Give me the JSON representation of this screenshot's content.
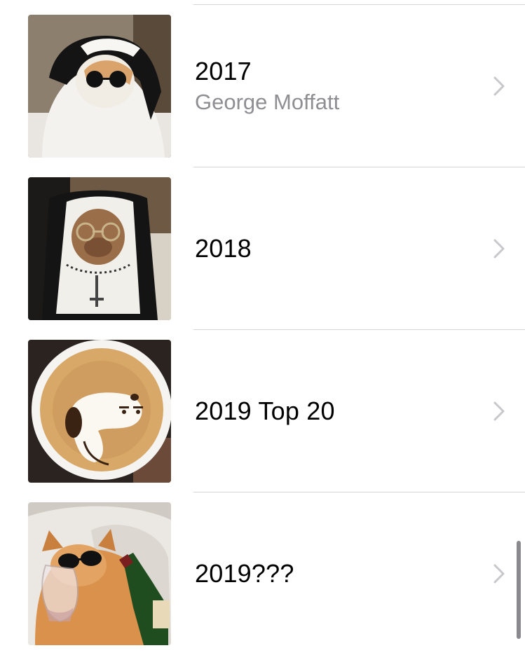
{
  "albums": [
    {
      "title": "2017",
      "subtitle": "George Moffatt",
      "thumbnail": "cat-in-nun-habit-sunglasses"
    },
    {
      "title": "2018",
      "subtitle": "",
      "thumbnail": "dog-in-nun-habit-glasses"
    },
    {
      "title": "2019 Top 20",
      "subtitle": "",
      "thumbnail": "snoopy-latte-art"
    },
    {
      "title": "2019???",
      "subtitle": "",
      "thumbnail": "cat-with-sunglasses-and-wine"
    }
  ],
  "icons": {
    "disclosure": "chevron-right-icon"
  },
  "colors": {
    "title": "#000000",
    "subtitle": "#8e8e93",
    "separator": "#d4d4d8",
    "chevron": "#c7c7cc",
    "scrollbar": "#8a8a8e"
  }
}
